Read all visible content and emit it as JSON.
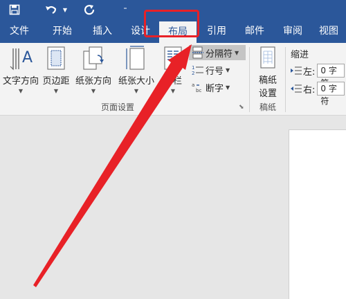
{
  "tabs": {
    "file": "文件",
    "home": "开始",
    "insert": "插入",
    "design": "设计",
    "layout": "布局",
    "references": "引用",
    "mailings": "邮件",
    "review": "审阅",
    "view": "视图"
  },
  "ribbon": {
    "text_direction": "文字方向",
    "margins": "页边距",
    "orientation": "纸张方向",
    "size": "纸张大小",
    "columns": "分栏",
    "breaks": "分隔符",
    "line_numbers": "行号",
    "hyphenation": "断字",
    "group_page_setup": "页面设置",
    "manuscript_line1": "稿纸",
    "manuscript_line2": "设置",
    "group_manuscript": "稿纸",
    "indent_title": "缩进",
    "indent_left_label": "左:",
    "indent_right_label": "右:",
    "indent_left_value": "0 字符",
    "indent_right_value": "0 字符"
  },
  "colors": {
    "brand": "#2b579a",
    "highlight": "#e82127",
    "arrow": "#e82127"
  }
}
